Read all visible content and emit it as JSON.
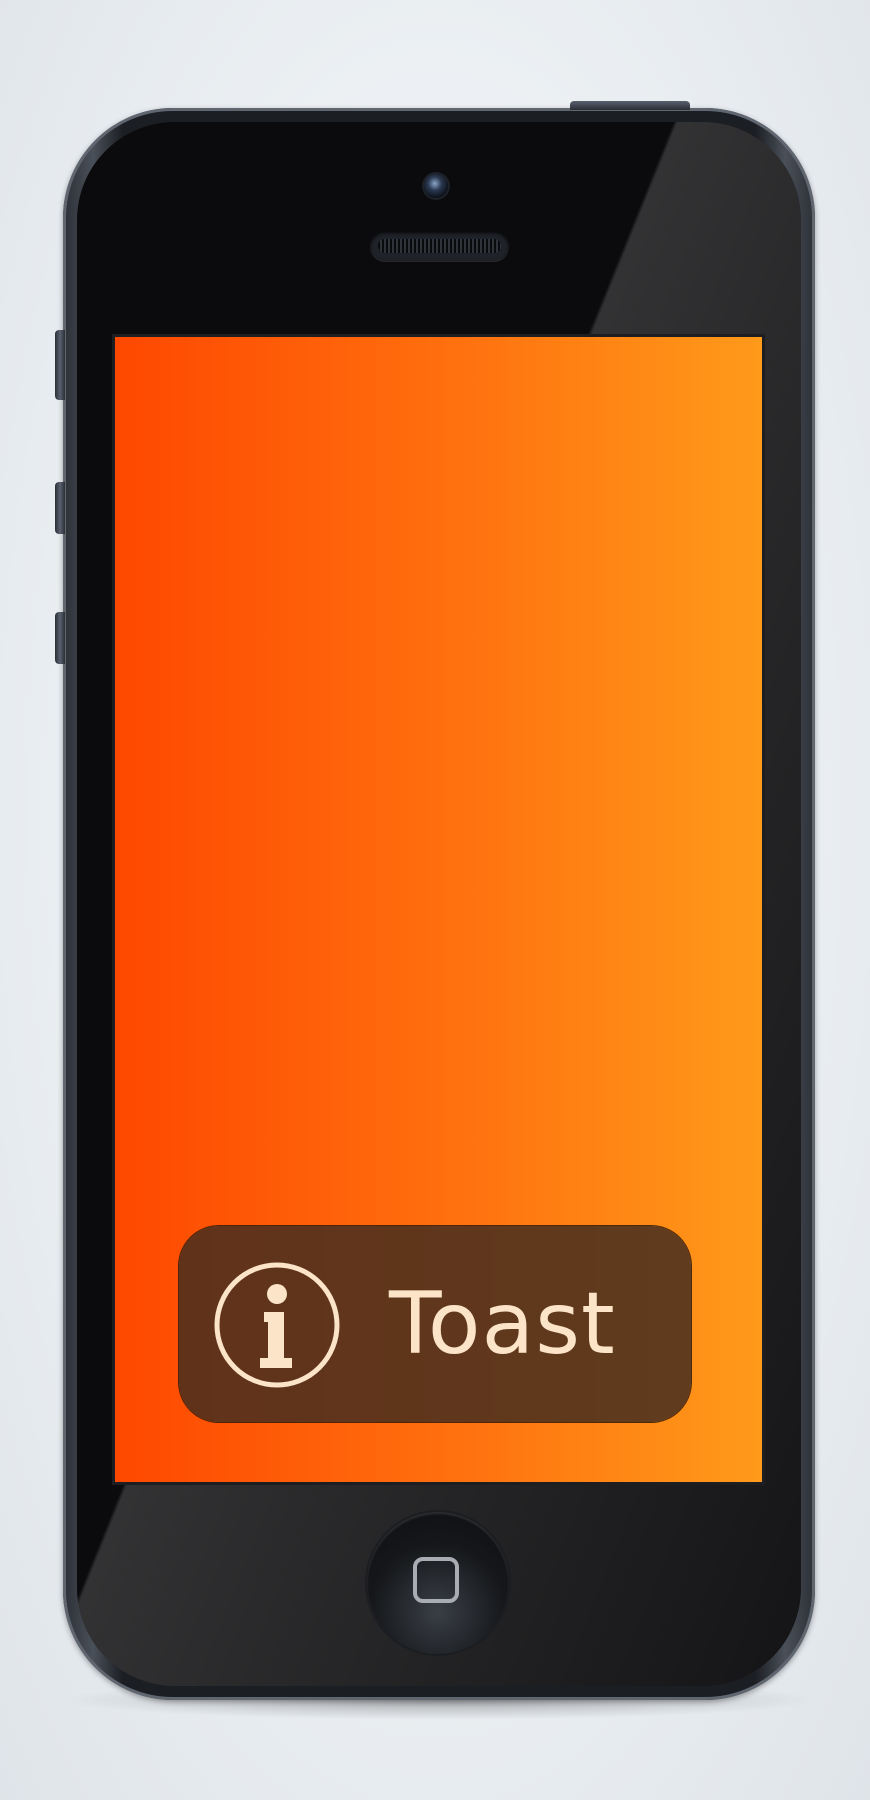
{
  "toast": {
    "label": "Toast",
    "icon": "info-icon",
    "text_color": "#fbe4c8"
  },
  "screen": {
    "gradient_start": "#fe4800",
    "gradient_end": "#ff9a1a"
  },
  "home_button": {
    "icon": "square-icon"
  }
}
